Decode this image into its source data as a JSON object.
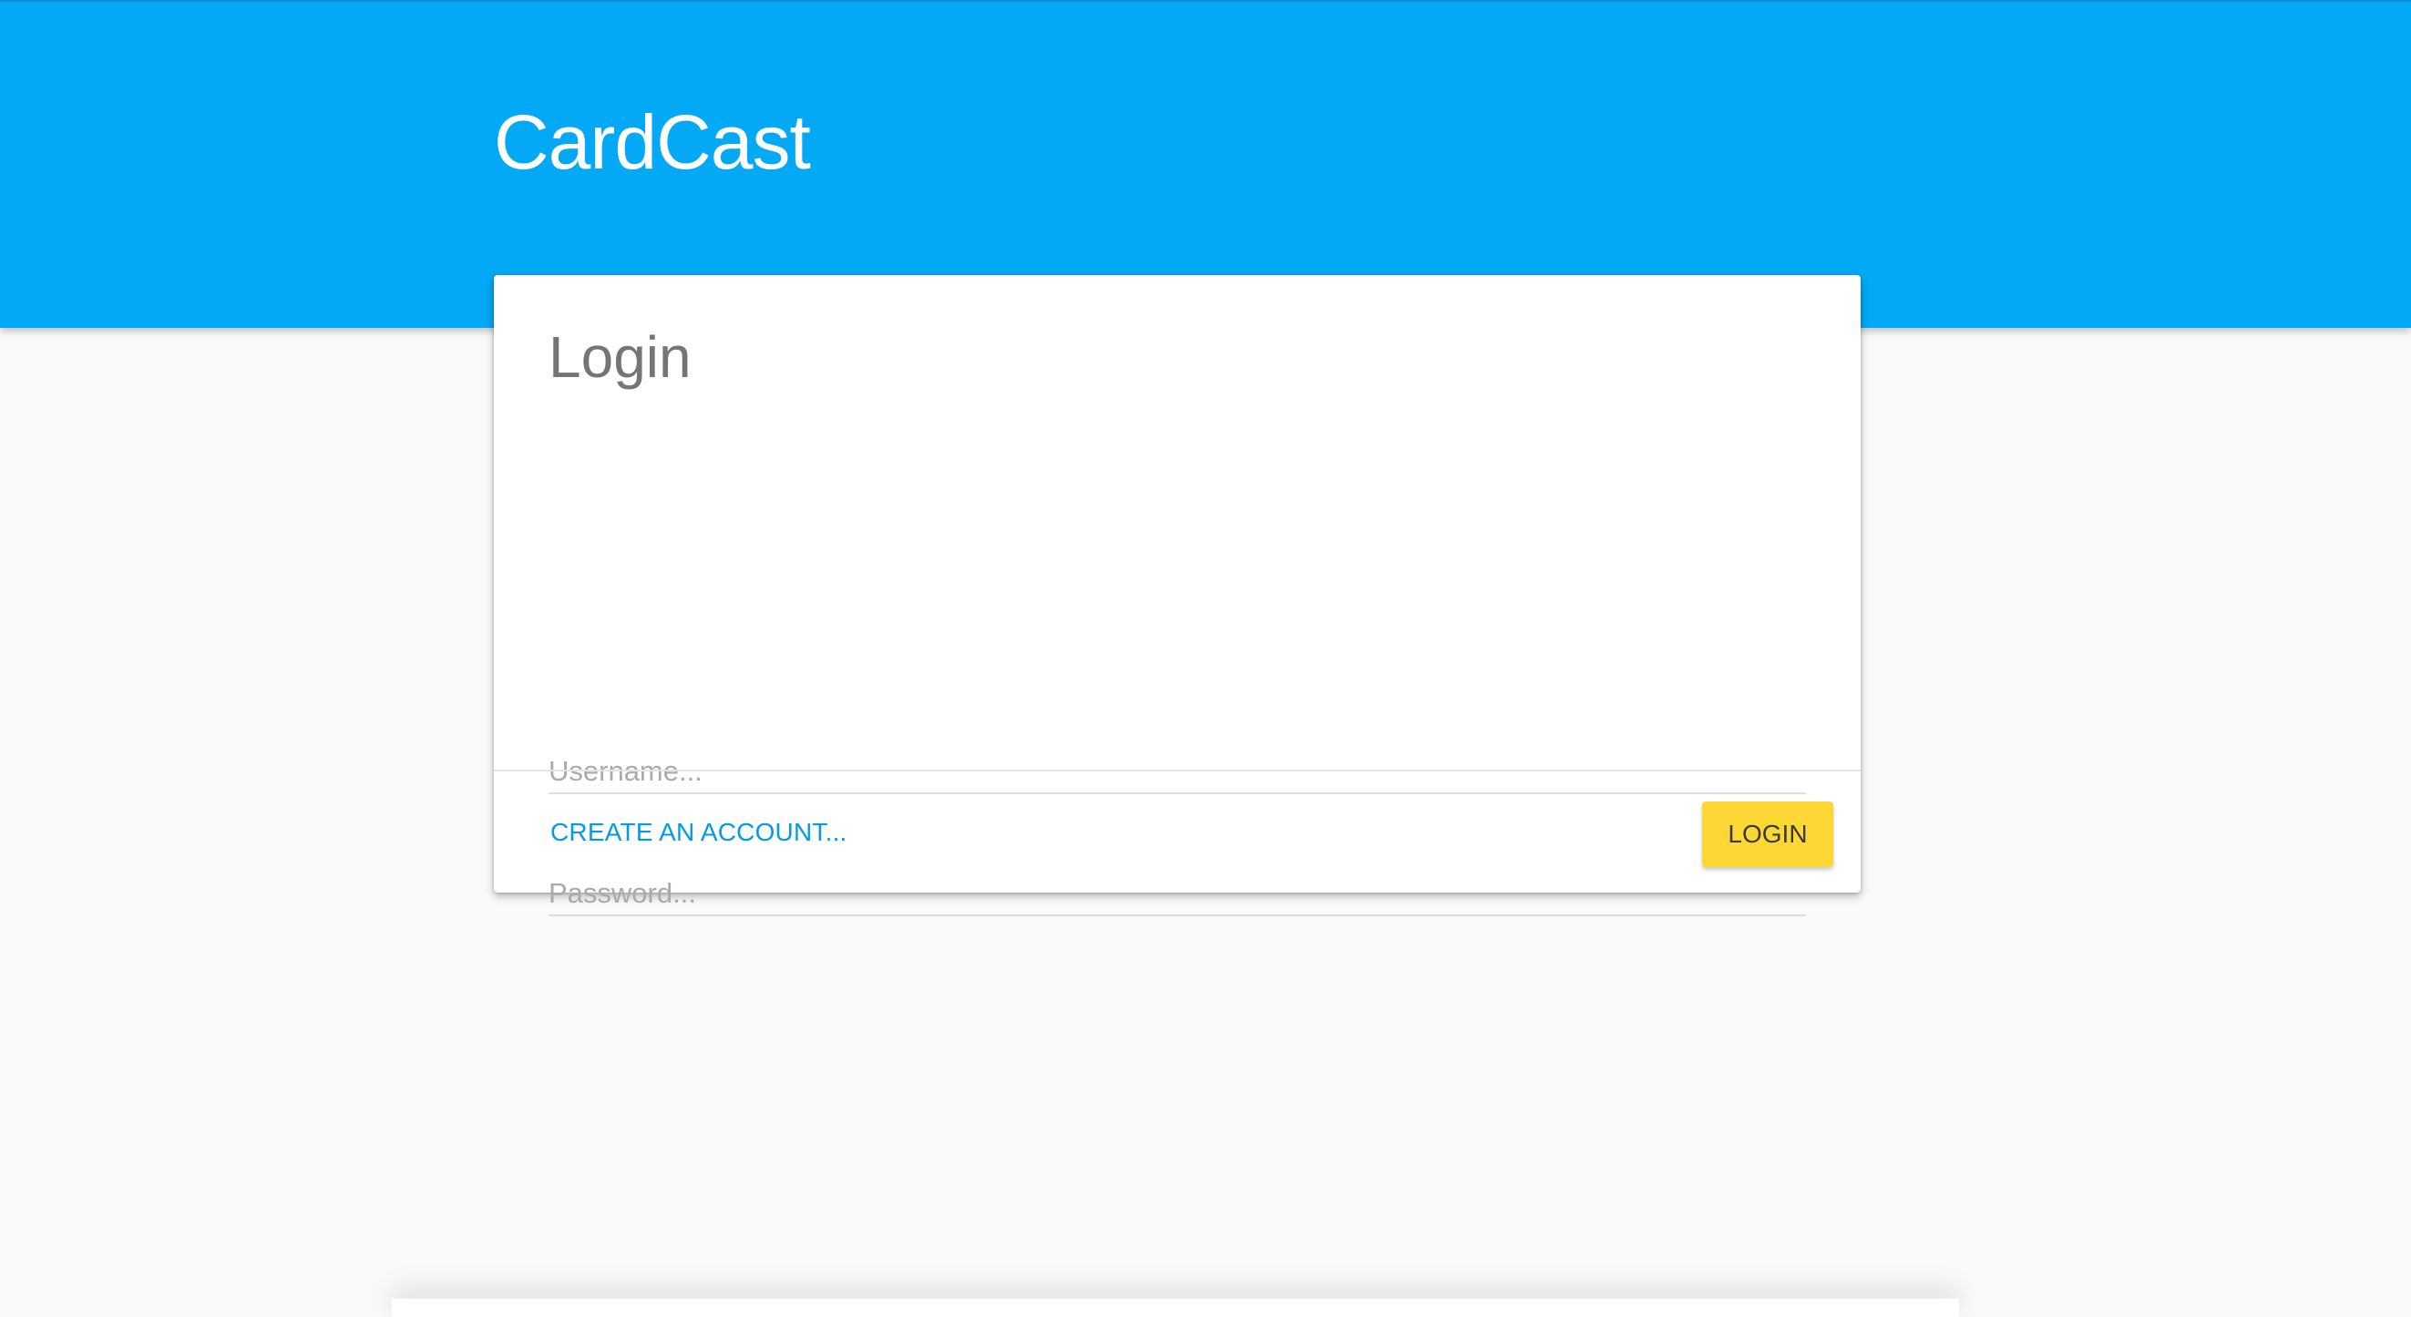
{
  "header": {
    "app_title": "CardCast"
  },
  "login_card": {
    "title": "Login",
    "username": {
      "placeholder": "Username...",
      "value": ""
    },
    "password": {
      "placeholder": "Password...",
      "value": ""
    },
    "create_account_label": "CREATE AN ACCOUNT...",
    "login_button_label": "LOGIN"
  },
  "colors": {
    "header_background": "#03a9f4",
    "page_background": "#fafafa",
    "link": "#039be5",
    "login_button": "#fdd835"
  }
}
